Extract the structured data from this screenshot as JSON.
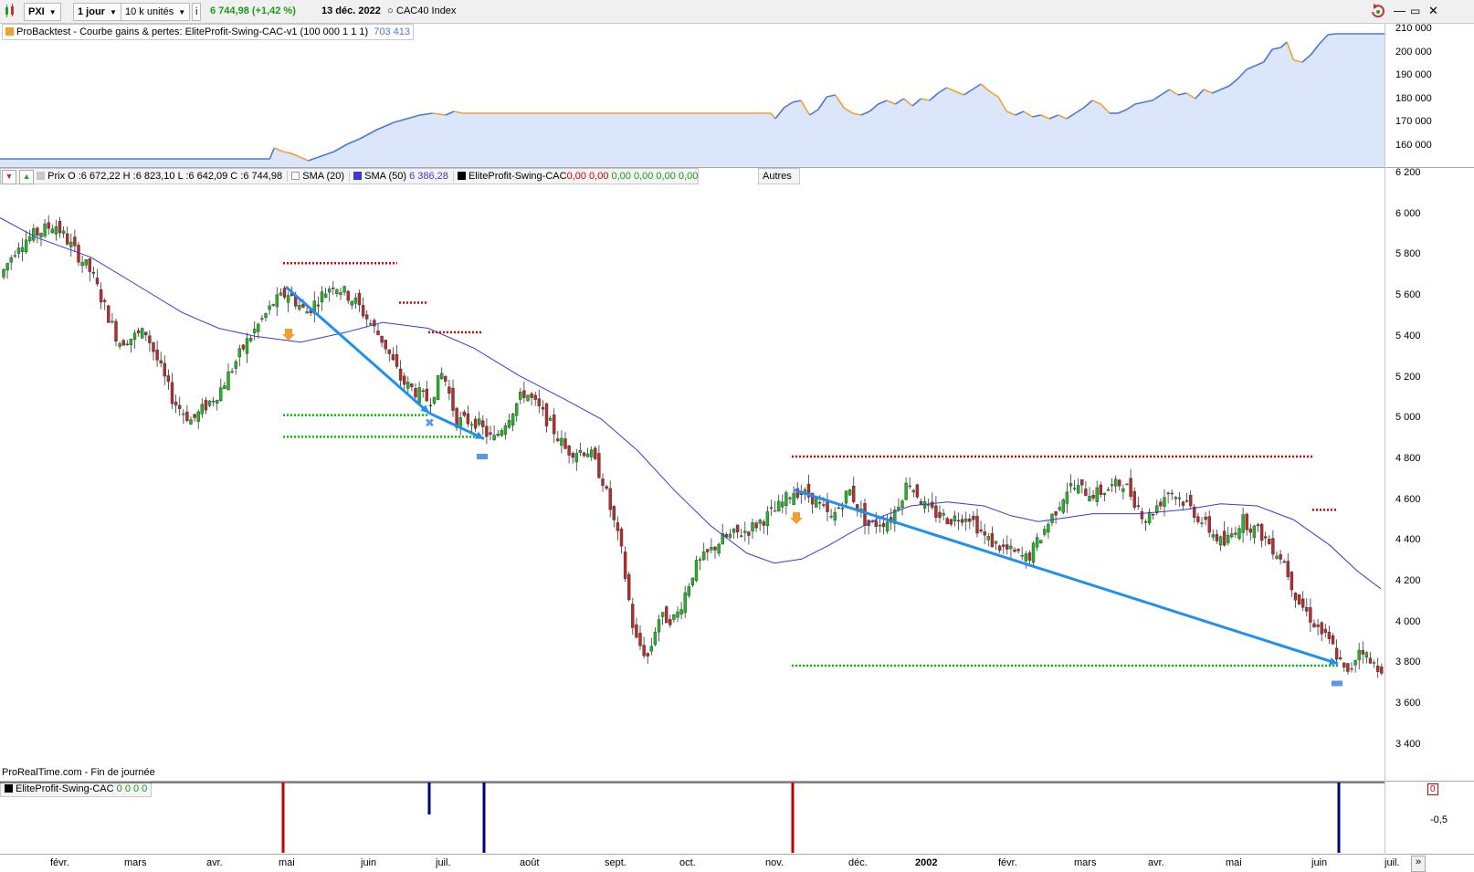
{
  "toolbar": {
    "symbol": "PXI",
    "period": "1 jour",
    "units": "10 k unités",
    "price_change": "6 744,98 (+1,42 %)",
    "date": "13 déc. 2022",
    "index_name": "CAC40 Index",
    "icons": [
      "candlestick-icon",
      "info-icon",
      "refresh-icon",
      "minimize-icon",
      "maximize-icon",
      "close-icon"
    ]
  },
  "equity_panel": {
    "legend_label": "ProBacktest - Courbe gains & pertes: EliteProfit-Swing-CAC-v1 (100 000 1 1 1)",
    "legend_value": "703 413",
    "y_ticks": [
      "210 000",
      "200 000",
      "190 000",
      "180 000",
      "170 000",
      "160 000"
    ],
    "colors": {
      "line_up": "#4a78d8",
      "line_down": "#f0a030",
      "fill": "#dbe6fa"
    }
  },
  "price_panel": {
    "legend": {
      "price": "Prix O :6 672,22 H :6 823,10 L :6 642,09 C :6 744,98",
      "sma20_label": "SMA (20)",
      "sma50_label": "SMA (50)",
      "sma50_value": "6 386,28",
      "indicator_label": "EliteProfit-Swing-CAC",
      "indicator_values_red": "0,00  0,00",
      "indicator_values_green": "0,00  0,00  0,00  0,00",
      "others_button": "Autres"
    },
    "y_ticks": [
      "6 200",
      "6 000",
      "5 800",
      "5 600",
      "5 400",
      "5 200",
      "5 000",
      "4 800",
      "4 600",
      "4 400",
      "4 200",
      "4 000",
      "3 800",
      "3 600",
      "3 400"
    ],
    "footer": "ProRealTime.com - Fin de journée",
    "colors": {
      "up": "#22b422",
      "down": "#b42c2c",
      "sma": "#3a3ad0",
      "trend": "#2090f0",
      "stop": "#e00000",
      "target": "#00c000"
    }
  },
  "indicator_panel": {
    "legend_label": "EliteProfit-Swing-CAC",
    "legend_values": "0 0 0 0",
    "zero_label": "0",
    "y_ticks": [
      "-0,5"
    ]
  },
  "x_axis": {
    "months": [
      "févr.",
      "mars",
      "avr.",
      "mai",
      "juin",
      "juil.",
      "août",
      "sept.",
      "oct.",
      "nov.",
      "déc.",
      "2002",
      "févr.",
      "mars",
      "avr.",
      "mai",
      "juin",
      "juil."
    ],
    "scroll_icon": "»"
  }
}
